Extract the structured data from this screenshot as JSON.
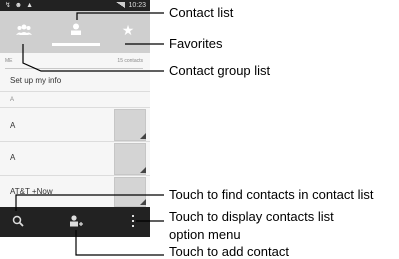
{
  "status_bar": {
    "left_icons": "↯ ☻ ▲",
    "time": "10:23"
  },
  "tabs": [
    {
      "name": "contact-groups",
      "icon": "groups-icon",
      "selected": false
    },
    {
      "name": "contacts",
      "icon": "person-icon",
      "selected": true
    },
    {
      "name": "favorites",
      "icon": "star-icon",
      "selected": false
    }
  ],
  "list": {
    "me_label": "ME",
    "contact_count": "15 contacts",
    "setup_label": "Set up my info",
    "section_header": "A",
    "rows": [
      "A",
      "A",
      "AT&T +Now"
    ]
  },
  "bottom_bar": {
    "icons": [
      "search-icon",
      "add-contact-icon",
      "menu-icon"
    ]
  },
  "callouts": {
    "contact_list": "Contact list",
    "favorites": "Favorites",
    "contact_group_list": "Contact group list",
    "find_contacts": "Touch to find contacts in contact list",
    "options_menu_line1": "Touch to display contacts list",
    "options_menu_line2": "option menu",
    "add_contact": "Touch to add contact"
  }
}
